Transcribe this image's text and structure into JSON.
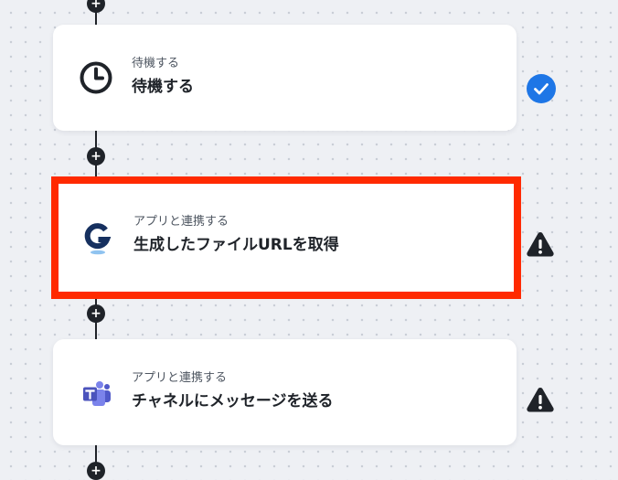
{
  "colors": {
    "canvas_bg": "#eef0f4",
    "card_bg": "#ffffff",
    "connector": "#1f2329",
    "highlight_border": "#ff2a00",
    "check_badge": "#1e76e6",
    "teams_purple": "#5a5fc7"
  },
  "flow": {
    "steps": [
      {
        "category": "待機する",
        "title": "待機する",
        "icon": "clock-icon",
        "status_icon": "check-circle-icon"
      },
      {
        "category": "アプリと連携する",
        "title": "生成したファイルURLを取得",
        "icon": "g-app-logo-icon",
        "status_icon": "warning-icon",
        "highlighted": true
      },
      {
        "category": "アプリと連携する",
        "title": "チャネルにメッセージを送る",
        "icon": "microsoft-teams-icon",
        "status_icon": "warning-icon"
      }
    ],
    "add_button_symbol": "+"
  }
}
